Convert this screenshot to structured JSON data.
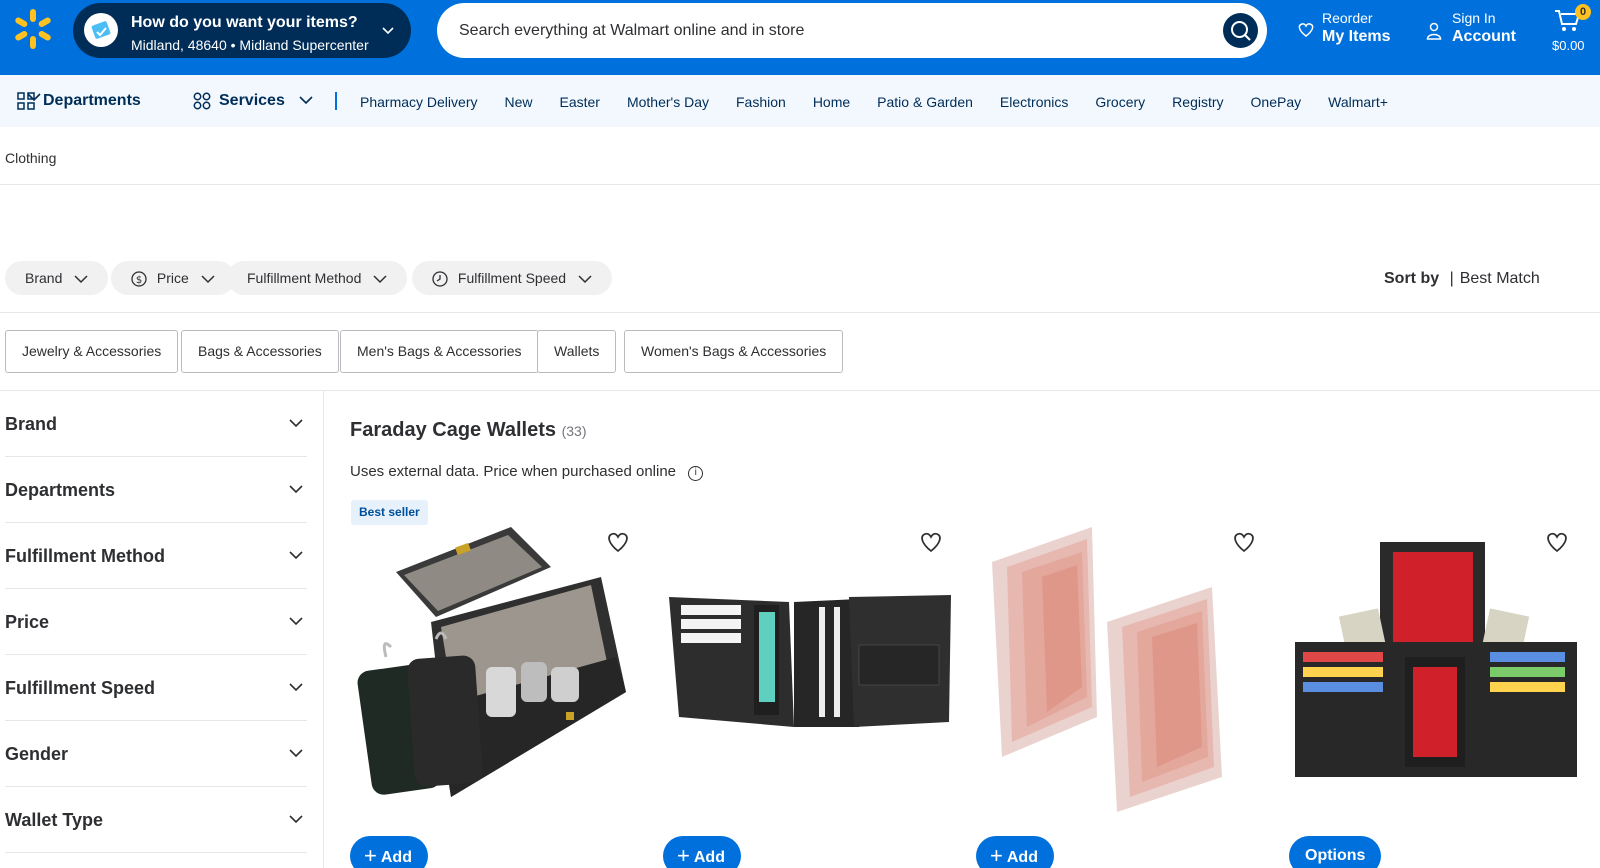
{
  "colors": {
    "brand_blue": "#0071dc",
    "dark_blue": "#002d58",
    "spark_yellow": "#ffc220"
  },
  "header": {
    "logo_icon": "walmart-spark-icon",
    "location": {
      "question": "How do you want your items?",
      "address": "Midland, 48640 • Midland Supercenter"
    },
    "search": {
      "placeholder": "Search everything at Walmart online and in store"
    },
    "reorder": {
      "small": "Reorder",
      "big": "My Items"
    },
    "account": {
      "small": "Sign In",
      "big": "Account"
    },
    "cart": {
      "count": "0",
      "total": "$0.00"
    }
  },
  "subnav": {
    "departments": "Departments",
    "services": "Services",
    "links": [
      "Pharmacy Delivery",
      "New",
      "Easter",
      "Mother's Day",
      "Fashion",
      "Home",
      "Patio & Garden",
      "Electronics",
      "Grocery",
      "Registry",
      "OnePay",
      "Walmart+"
    ]
  },
  "breadcrumb": "Clothing",
  "filters": {
    "pills": [
      "Brand",
      "Price",
      "Fulfillment Method",
      "Fulfillment Speed"
    ],
    "sort_label": "Sort by",
    "sort_value": "Best Match"
  },
  "chips": [
    "Jewelry & Accessories",
    "Bags & Accessories",
    "Men's Bags & Accessories",
    "Wallets",
    "Women's Bags & Accessories"
  ],
  "sidebar": {
    "facets": [
      "Brand",
      "Departments",
      "Fulfillment Method",
      "Price",
      "Fulfillment Speed",
      "Gender",
      "Wallet Type"
    ]
  },
  "results": {
    "title": "Faraday Cage Wallets",
    "count": "(33)",
    "disclaimer": "Uses external data. Price when purchased online",
    "badge": "Best seller",
    "products": [
      {
        "button": "Add",
        "image": "faraday-box-with-key-pouches"
      },
      {
        "button": "Add",
        "image": "black-trifold-wallet"
      },
      {
        "button": "Add",
        "image": "plastic-card-insert-pages"
      },
      {
        "button": "Options",
        "image": "marshal-trifold-wallet-with-cards"
      }
    ]
  }
}
